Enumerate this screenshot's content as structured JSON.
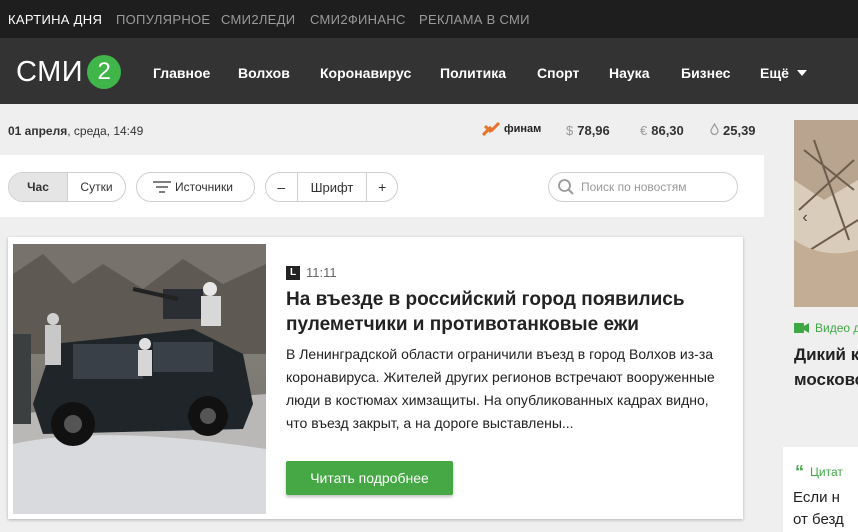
{
  "topbar": {
    "items": [
      "КАРТИНА ДНЯ",
      "ПОПУЛЯРНОЕ",
      "СМИ2ЛЕДИ",
      "СМИ2ФИНАНС",
      "РЕКЛАМА В СМИ"
    ]
  },
  "logo": {
    "text": "СМИ",
    "number": "2"
  },
  "nav": {
    "items": [
      "Главное",
      "Волхов",
      "Коронавирус",
      "Политика",
      "Спорт",
      "Наука",
      "Бизнес",
      "Ещё"
    ]
  },
  "info": {
    "date": "01 апреля",
    "weekday_time": ", среда, 14:49",
    "partner": "финам",
    "rates": [
      {
        "symbol": "$",
        "value": "78,96"
      },
      {
        "symbol": "€",
        "value": "86,30"
      },
      {
        "symbol": "💧",
        "value": "25,39"
      }
    ]
  },
  "toolbar": {
    "period": [
      "Час",
      "Сутки"
    ],
    "sources_label": "Источники",
    "font_minus": "–",
    "font_label": "Шрифт",
    "font_plus": "+",
    "search_placeholder": "Поиск по новостям"
  },
  "news": {
    "time": "11:11",
    "badge": "L",
    "headline": "На въезде в российский город появились пулеметчики и противотанковые ежи",
    "lead": "В Ленинградской области ограничили въезд в город Волхов из-за коронавируса. Жителей других регионов встречают вооруженные люди в костюмах химзащиты. На опубликованных кадрах видно, что въезд закрыт, а на дороге выставлены...",
    "button": "Читать подробнее"
  },
  "side": {
    "video_label": "Видео д",
    "title_line1": "Дикий к",
    "title_line2": "московс",
    "quote_label": "Цитат",
    "quote_line1": "Если н",
    "quote_line2": "от безд"
  },
  "colors": {
    "accent_green": "#3fb54a",
    "topbar_bg": "#1e1e1e",
    "nav_bg": "#333333"
  }
}
